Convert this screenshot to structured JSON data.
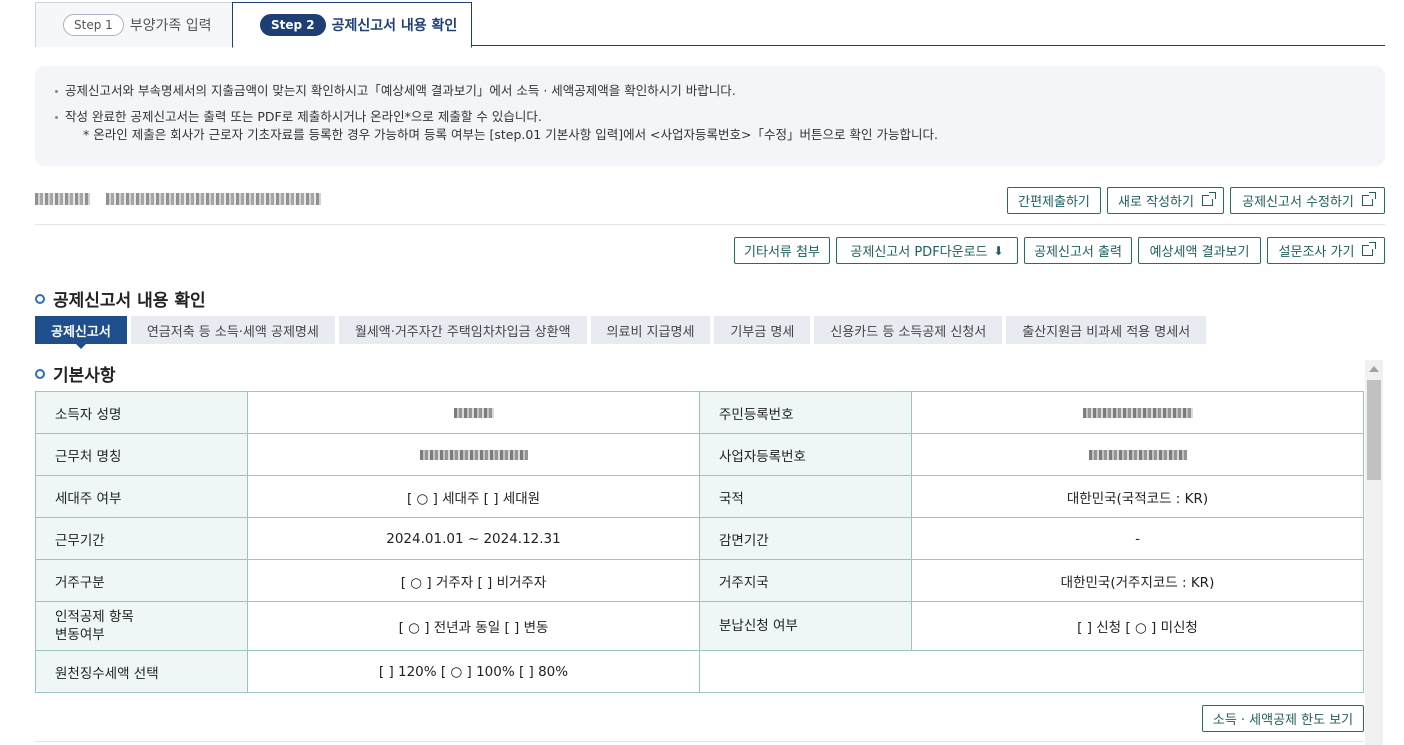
{
  "steps": [
    {
      "pill": "Step 1",
      "label": "부양가족 입력"
    },
    {
      "pill": "Step 2",
      "label": "공제신고서 내용 확인"
    }
  ],
  "notice": {
    "line1": "공제신고서와 부속명세서의 지출금액이 맞는지 확인하시고「예상세액 결과보기」에서 소득 · 세액공제액을 확인하시기 바랍니다.",
    "line2": "작성 완료한 공제신고서는 출력 또는 PDF로 제출하시거나 온라인*으로 제출할 수 있습니다.",
    "line3": "* 온라인 제출은 회사가 근로자 기초자료를 등록한 경우 가능하며 등록 여부는 [step.01 기본사항 입력]에서 <사업자등록번호>「수정」버튼으로 확인 가능합니다."
  },
  "top_buttons": {
    "simple_submit": "간편제출하기",
    "new_write": "새로 작성하기",
    "edit_report": "공제신고서 수정하기"
  },
  "action_buttons": {
    "attach_docs": "기타서류 첨부",
    "pdf_download": "공제신고서 PDF다운로드",
    "print": "공제신고서 출력",
    "estimate": "예상세액 결과보기",
    "survey": "설문조사 가기"
  },
  "section_title": "공제신고서 내용 확인",
  "subtabs": [
    "공제신고서",
    "연금저축 등 소득·세액 공제명세",
    "월세액·거주자간 주택임차차입금 상환액",
    "의료비 지급명세",
    "기부금 명세",
    "신용카드 등 소득공제 신청서",
    "출산지원금 비과세 적용 명세서"
  ],
  "basic_title": "기본사항",
  "table": {
    "r1": {
      "h1": "소득자 성명",
      "h2": "주민등록번호"
    },
    "r2": {
      "h1": "근무처 명칭",
      "h2": "사업자등록번호"
    },
    "r3": {
      "h1": "세대주 여부",
      "v1": "[ ○ ] 세대주  [    ] 세대원",
      "h2": "국적",
      "v2": "대한민국(국적코드 : KR)"
    },
    "r4": {
      "h1": "근무기간",
      "v1": "2024.01.01 ~ 2024.12.31",
      "h2": "감면기간",
      "v2": "-"
    },
    "r5": {
      "h1": "거주구분",
      "v1": "[ ○ ] 거주자  [    ] 비거주자",
      "h2": "거주지국",
      "v2": "대한민국(거주지코드 : KR)"
    },
    "r6": {
      "h1a": "인적공제 항목",
      "h1b": "변동여부",
      "v1": "[ ○ ] 전년과 동일  [    ] 변동",
      "h2": "분납신청 여부",
      "v2": "[    ] 신청 [ ○ ] 미신청"
    },
    "r7": {
      "h1": "원천징수세액 선택",
      "v1": "[    ] 120%  [ ○ ] 100% [    ] 80%"
    }
  },
  "limit_button": "소득 · 세액공제 한도 보기"
}
